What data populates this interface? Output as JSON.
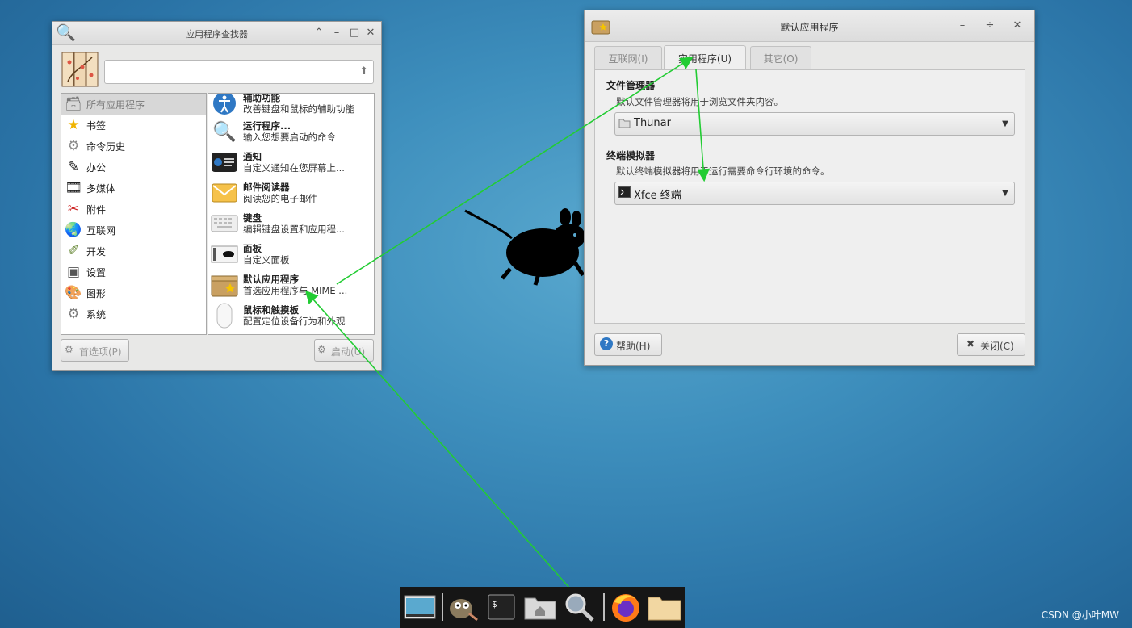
{
  "finder": {
    "title": "应用程序查找器",
    "search": {
      "value": "",
      "placeholder": ""
    },
    "categories": [
      {
        "label": "所有应用程序",
        "icon": "all-apps-icon"
      },
      {
        "label": "书签",
        "icon": "star-icon"
      },
      {
        "label": "命令历史",
        "icon": "gears-icon"
      },
      {
        "label": "办公",
        "icon": "office-icon"
      },
      {
        "label": "多媒体",
        "icon": "multimedia-icon"
      },
      {
        "label": "附件",
        "icon": "accessories-icon"
      },
      {
        "label": "互联网",
        "icon": "globe-icon"
      },
      {
        "label": "开发",
        "icon": "development-icon"
      },
      {
        "label": "设置",
        "icon": "settings-icon"
      },
      {
        "label": "图形",
        "icon": "graphics-icon"
      },
      {
        "label": "系统",
        "icon": "system-icon"
      }
    ],
    "apps": [
      {
        "name": "辅助功能",
        "desc": "改善键盘和鼠标的辅助功能",
        "icon": "accessibility-icon"
      },
      {
        "name": "运行程序...",
        "desc": "输入您想要启动的命令",
        "icon": "magnifier-icon"
      },
      {
        "name": "通知",
        "desc": "自定义通知在您屏幕上...",
        "icon": "notification-icon"
      },
      {
        "name": "邮件阅读器",
        "desc": "阅读您的电子邮件",
        "icon": "mail-icon"
      },
      {
        "name": "键盘",
        "desc": "编辑键盘设置和应用程...",
        "icon": "keyboard-icon"
      },
      {
        "name": "面板",
        "desc": "自定义面板",
        "icon": "panel-icon"
      },
      {
        "name": "默认应用程序",
        "desc": "首选应用程序与 MIME ...",
        "icon": "default-apps-icon"
      },
      {
        "name": "鼠标和触摸板",
        "desc": "配置定位设备行为和外观",
        "icon": "mouse-icon"
      }
    ],
    "prefs_label": "首选项(P)",
    "launch_label": "启动(U)"
  },
  "defapps": {
    "title": "默认应用程序",
    "tabs": [
      "互联网(I)",
      "实用程序(U)",
      "其它(O)"
    ],
    "file_manager": {
      "title": "文件管理器",
      "desc": "默认文件管理器将用于浏览文件夹内容。",
      "value": "Thunar"
    },
    "terminal": {
      "title": "终端模拟器",
      "desc": "默认终端模拟器将用于运行需要命令行环境的命令。",
      "value": "Xfce 终端"
    },
    "help_label": "帮助(H)",
    "close_label": "关闭(C)"
  },
  "watermark": "CSDN @小叶MW",
  "colors": {
    "arrow": "#22cc33",
    "desktop": "#3e8fbd"
  }
}
